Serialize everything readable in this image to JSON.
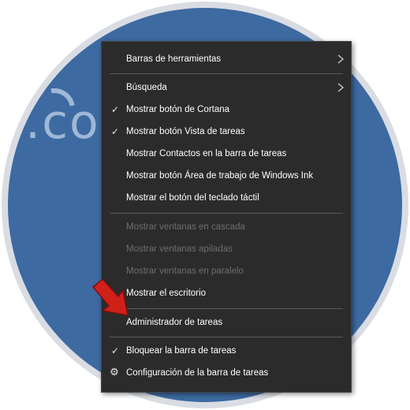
{
  "background": {
    "logo_text": ".co",
    "circle_color": "#3d6aa1",
    "ring_color": "#d9dde3"
  },
  "menu": {
    "background": "#2b2b2b",
    "items": [
      {
        "label": "Barras de herramientas",
        "checked": false,
        "enabled": true,
        "submenu": true
      },
      {
        "label": "Búsqueda",
        "checked": false,
        "enabled": true,
        "submenu": true
      },
      {
        "label": "Mostrar botón de Cortana",
        "checked": true,
        "enabled": true
      },
      {
        "label": "Mostrar botón Vista de tareas",
        "checked": true,
        "enabled": true
      },
      {
        "label": "Mostrar Contactos en la barra de tareas",
        "checked": false,
        "enabled": true
      },
      {
        "label": "Mostrar botón Área de trabajo de Windows Ink",
        "checked": false,
        "enabled": true
      },
      {
        "label": "Mostrar el botón del teclado táctil",
        "checked": false,
        "enabled": true
      },
      {
        "label": "Mostrar ventanas en cascada",
        "checked": false,
        "enabled": false
      },
      {
        "label": "Mostrar ventanas apiladas",
        "checked": false,
        "enabled": false
      },
      {
        "label": "Mostrar ventanas en paralelo",
        "checked": false,
        "enabled": false
      },
      {
        "label": "Mostrar el escritorio",
        "checked": false,
        "enabled": true
      },
      {
        "label": "Administrador de tareas",
        "checked": false,
        "enabled": true
      },
      {
        "label": "Bloquear la barra de tareas",
        "checked": true,
        "enabled": true
      },
      {
        "label": "Configuración de la barra de tareas",
        "checked": false,
        "enabled": true,
        "icon": "gear-icon"
      }
    ]
  },
  "annotation": {
    "arrow_color": "#d0201a",
    "points_to": "Administrador de tareas"
  }
}
